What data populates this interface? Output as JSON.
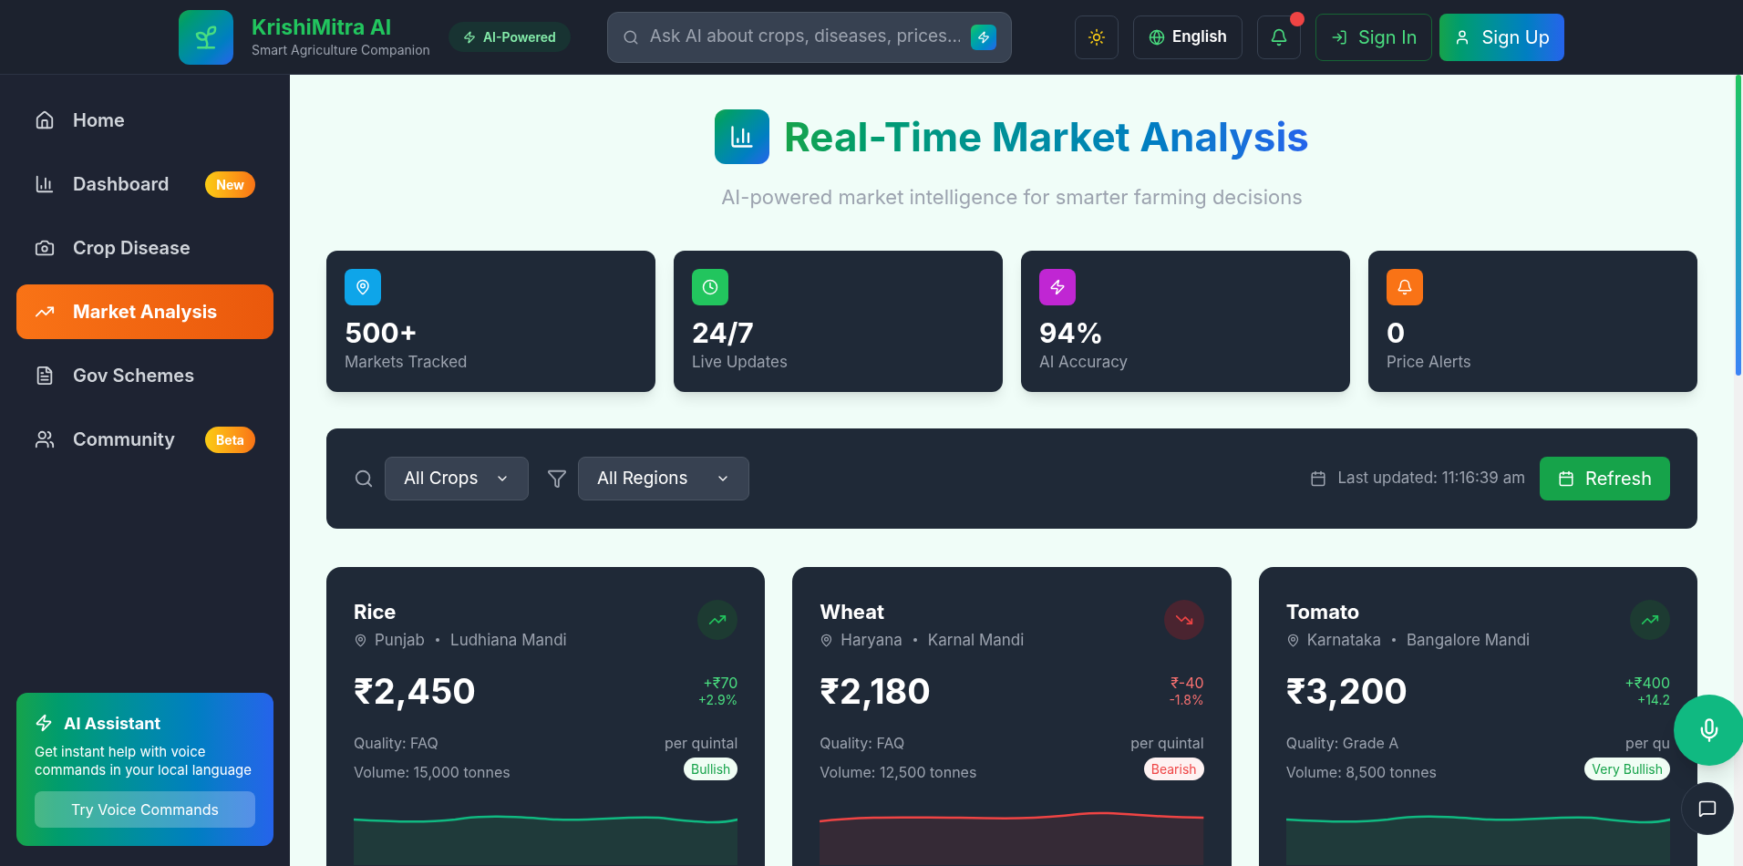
{
  "header": {
    "brand": "KrishiMitra AI",
    "tagline": "Smart Agriculture Companion",
    "badge": "AI-Powered",
    "search": {
      "placeholder": "Ask AI about crops, diseases, prices..."
    },
    "language": "English",
    "notification_dot": true,
    "sign_in": "Sign In",
    "sign_up": "Sign Up"
  },
  "sidebar": {
    "items": [
      {
        "label": "Home",
        "selected": false
      },
      {
        "label": "Dashboard",
        "selected": false,
        "badge": "New"
      },
      {
        "label": "Crop Disease",
        "selected": false
      },
      {
        "label": "Market Analysis",
        "selected": true
      },
      {
        "label": "Gov Schemes",
        "selected": false
      },
      {
        "label": "Community",
        "selected": false,
        "badge": "Beta"
      }
    ],
    "assistant": {
      "title": "AI Assistant",
      "text": "Get instant help with voice commands in your local language",
      "button": "Try Voice Commands"
    }
  },
  "page": {
    "title": "Real-Time Market Analysis",
    "subtitle": "AI-powered market intelligence for smarter farming decisions"
  },
  "stats": [
    {
      "value": "500+",
      "label": "Markets Tracked",
      "color": "#0ea5e9"
    },
    {
      "value": "24/7",
      "label": "Live Updates",
      "color": "#22c55e"
    },
    {
      "value": "94%",
      "label": "AI Accuracy",
      "color": "#c026d3"
    },
    {
      "value": "0",
      "label": "Price Alerts",
      "color": "#f97316"
    }
  ],
  "filters": {
    "crop": "All Crops",
    "region": "All Regions",
    "last_updated": "Last updated: 11:16:39 am",
    "refresh": "Refresh"
  },
  "crops": [
    {
      "name": "Rice",
      "state": "Punjab",
      "mandi": "Ludhiana Mandi",
      "price": "₹2,450",
      "change": "+₹70",
      "percent": "+2.9%",
      "quality": "Quality: FAQ",
      "volume": "Volume: 15,000 tonnes",
      "unit": "per quintal",
      "sentiment": "Bullish",
      "kind": "up"
    },
    {
      "name": "Wheat",
      "state": "Haryana",
      "mandi": "Karnal Mandi",
      "price": "₹2,180",
      "change": "₹-40",
      "percent": "-1.8%",
      "quality": "Quality: FAQ",
      "volume": "Volume: 12,500 tonnes",
      "unit": "per quintal",
      "sentiment": "Bearish",
      "kind": "down"
    },
    {
      "name": "Tomato",
      "state": "Karnataka",
      "mandi": "Bangalore Mandi",
      "price": "₹3,200",
      "change": "+₹400",
      "percent": "+14.2",
      "quality": "Quality: Grade A",
      "volume": "Volume: 8,500 tonnes",
      "unit": "per qu",
      "sentiment": "Very Bullish",
      "kind": "up"
    }
  ]
}
